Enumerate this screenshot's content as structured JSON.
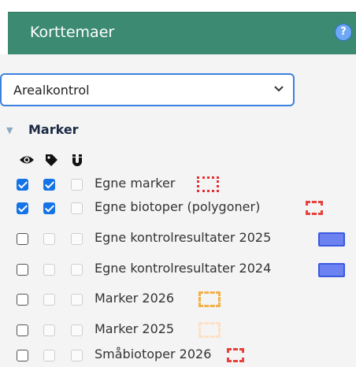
{
  "header": {
    "title": "Korttemaer",
    "help_glyph": "?"
  },
  "select": {
    "value": "Arealkontrol"
  },
  "group": {
    "label": "Marker",
    "expanded": true
  },
  "columns": [
    "eye-icon",
    "tag-icon",
    "magnet-icon"
  ],
  "rows": [
    {
      "label": "Egne marker",
      "c1": true,
      "c2": true,
      "c3": false,
      "swatch": "red-dotted"
    },
    {
      "label": "Egne biotoper (polygoner)",
      "c1": true,
      "c2": true,
      "c3": false,
      "swatch": "red-dashed"
    },
    {
      "label": "Egne kontrolresultater 2025",
      "c1": false,
      "c2": false,
      "c3": false,
      "swatch": "blue-fill"
    },
    {
      "label": "Egne kontrolresultater 2024",
      "c1": false,
      "c2": false,
      "c3": false,
      "swatch": "blue-fill"
    },
    {
      "label": "Marker 2026",
      "c1": false,
      "c2": false,
      "c3": false,
      "swatch": "orange-dashed"
    },
    {
      "label": "Marker 2025",
      "c1": false,
      "c2": false,
      "c3": false,
      "swatch": "peach-dashed"
    },
    {
      "label": "Småbiotoper 2026",
      "c1": false,
      "c2": false,
      "c3": false,
      "swatch": "red-dashed"
    }
  ],
  "colors": {
    "header_bg": "#3d8a73",
    "checkbox_checked": "#1473e6",
    "select_border": "#3b82e0",
    "swatch_red": "#e53030",
    "swatch_blue": "#6b82f0",
    "swatch_orange": "#f2b14a",
    "swatch_peach": "#fbe1c8"
  }
}
